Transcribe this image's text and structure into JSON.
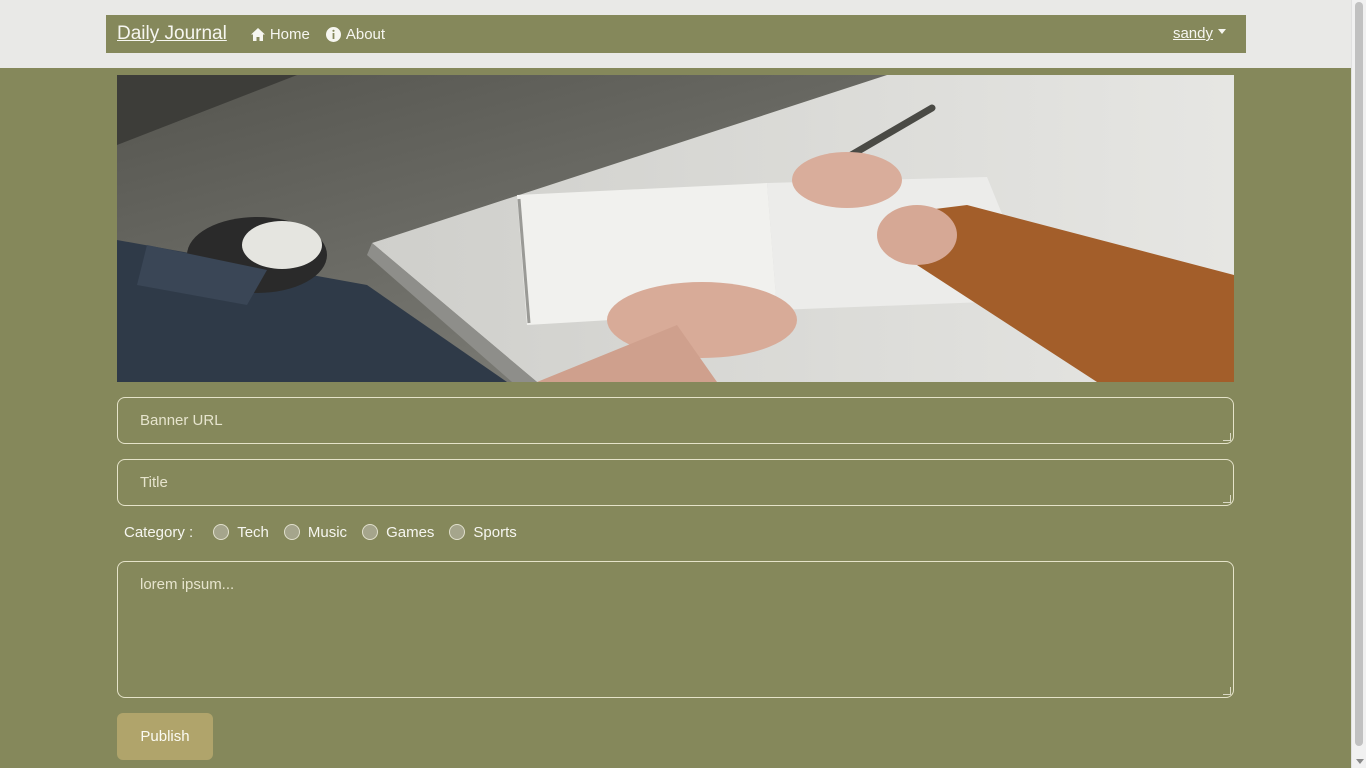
{
  "app": {
    "brand": "Daily Journal"
  },
  "nav": {
    "home_label": "Home",
    "about_label": "About",
    "user_label": "sandy"
  },
  "banner": {
    "icon": "banner-image"
  },
  "form": {
    "banner_url_placeholder": "Banner URL",
    "title_placeholder": "Title",
    "category_label": "Category :",
    "categories": [
      "Tech",
      "Music",
      "Games",
      "Sports"
    ],
    "body_placeholder": "lorem ipsum...",
    "publish_label": "Publish"
  },
  "colors": {
    "background": "#85885b",
    "top_strip": "#e9e9e7",
    "publish_button": "#b0a46b",
    "field_border": "#e5e3c9"
  }
}
